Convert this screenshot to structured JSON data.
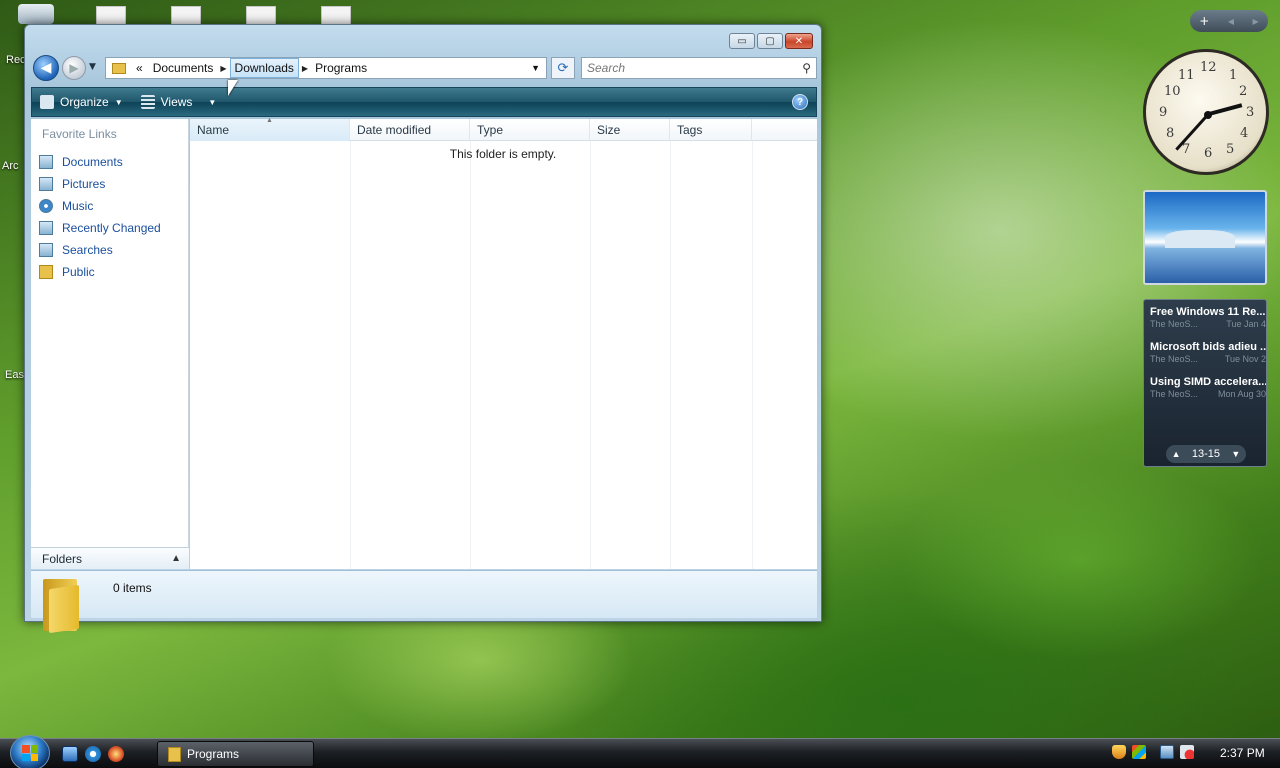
{
  "desktop": {
    "labels": [
      "Rec",
      "Arc",
      "Eas"
    ]
  },
  "window": {
    "caption_buttons": {
      "minimize": "▭",
      "maximize": "▢",
      "close": "✕"
    },
    "address": {
      "chevron": "«",
      "crumbs": [
        "Documents",
        "Downloads",
        "Programs"
      ],
      "refresh_glyph": "⟳"
    },
    "search": {
      "placeholder": "Search"
    },
    "toolbar": {
      "organize_label": "Organize",
      "views_label": "Views",
      "help_glyph": "?"
    },
    "nav_pane": {
      "heading": "Favorite Links",
      "items": [
        {
          "label": "Documents",
          "icon": "documents-icon"
        },
        {
          "label": "Pictures",
          "icon": "pictures-icon"
        },
        {
          "label": "Music",
          "icon": "music-icon"
        },
        {
          "label": "Recently Changed",
          "icon": "recent-icon"
        },
        {
          "label": "Searches",
          "icon": "searches-icon"
        },
        {
          "label": "Public",
          "icon": "folder-icon"
        }
      ],
      "folders_label": "Folders"
    },
    "columns": [
      "Name",
      "Date modified",
      "Type",
      "Size",
      "Tags"
    ],
    "empty_message": "This folder is empty.",
    "details": {
      "item_count": "0 items"
    }
  },
  "gadgets": {
    "sidebar_controls": {
      "add": "+",
      "prev": "◀",
      "next": "▶"
    },
    "clock": {
      "numbers": [
        "12",
        "1",
        "2",
        "3",
        "4",
        "5",
        "6",
        "7",
        "8",
        "9",
        "10",
        "11"
      ]
    },
    "feeds": {
      "items": [
        {
          "title": "Free Windows 11 Re...",
          "source": "The NeoS...",
          "date": "Tue Jan 4"
        },
        {
          "title": "Microsoft bids adieu ...",
          "source": "The NeoS...",
          "date": "Tue Nov 2"
        },
        {
          "title": "Using SIMD accelera...",
          "source": "The NeoS...",
          "date": "Mon Aug 30"
        }
      ],
      "range": "13-15"
    }
  },
  "taskbar": {
    "task_label": "Programs",
    "time": "2:37 PM"
  },
  "colors": {
    "link_blue": "#1b4f9c",
    "toolbar_teal": "#1f566b",
    "taskbar_dark": "#1c1f23"
  }
}
